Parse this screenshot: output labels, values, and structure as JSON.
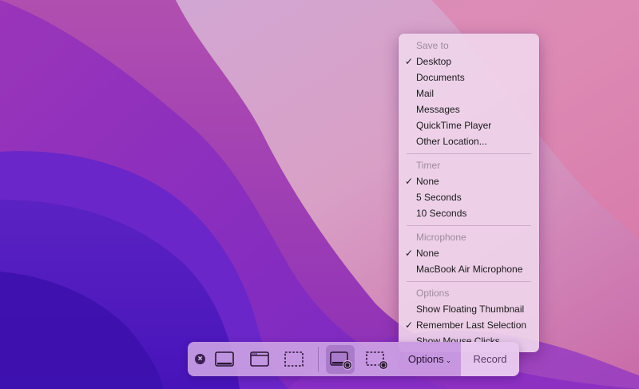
{
  "menu": {
    "sections": [
      {
        "header": "Save to",
        "items": [
          {
            "label": "Desktop",
            "checked": true
          },
          {
            "label": "Documents",
            "checked": false
          },
          {
            "label": "Mail",
            "checked": false
          },
          {
            "label": "Messages",
            "checked": false
          },
          {
            "label": "QuickTime Player",
            "checked": false
          },
          {
            "label": "Other Location...",
            "checked": false
          }
        ]
      },
      {
        "header": "Timer",
        "items": [
          {
            "label": "None",
            "checked": true
          },
          {
            "label": "5 Seconds",
            "checked": false
          },
          {
            "label": "10 Seconds",
            "checked": false
          }
        ]
      },
      {
        "header": "Microphone",
        "items": [
          {
            "label": "None",
            "checked": true
          },
          {
            "label": "MacBook Air Microphone",
            "checked": false
          }
        ]
      },
      {
        "header": "Options",
        "items": [
          {
            "label": "Show Floating Thumbnail",
            "checked": false
          },
          {
            "label": "Remember Last Selection",
            "checked": true
          },
          {
            "label": "Show Mouse Clicks",
            "checked": false
          }
        ]
      }
    ],
    "check_glyph": "✓"
  },
  "toolbar": {
    "close_glyph": "×",
    "buttons": [
      {
        "icon": "capture-entire-screen-icon",
        "selected": false
      },
      {
        "icon": "capture-window-icon",
        "selected": false
      },
      {
        "icon": "capture-selection-icon",
        "selected": false
      },
      {
        "icon": "record-entire-screen-icon",
        "selected": true
      },
      {
        "icon": "record-selection-icon",
        "selected": false
      }
    ],
    "options_label": "Options",
    "options_chevron": "⌄",
    "record_label": "Record"
  },
  "colors": {
    "menu_bg": "#f0d6ec",
    "toolbar_bg": "#d2aae6",
    "wallpaper_dark": "#4a14b8",
    "wallpaper_pink": "#d66aa8"
  }
}
